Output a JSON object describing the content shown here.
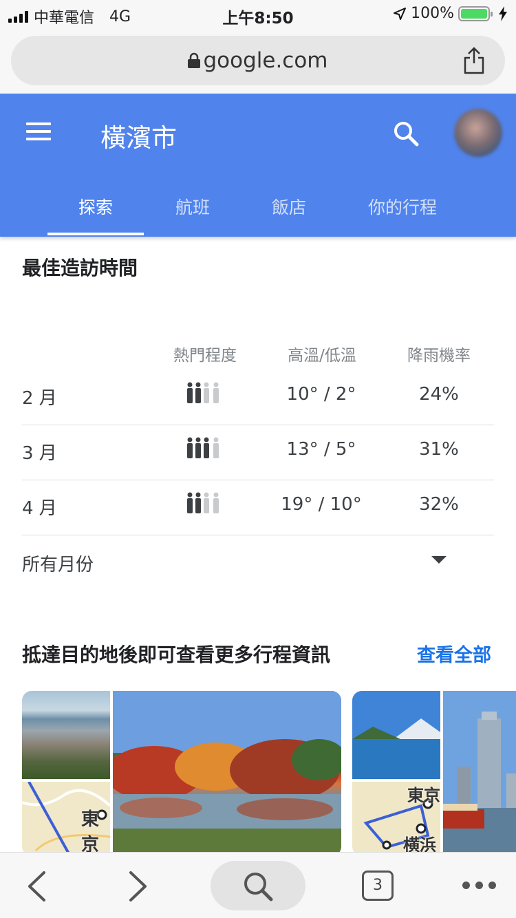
{
  "status_bar": {
    "carrier": "中華電信",
    "network": "4G",
    "time": "上午8:50",
    "battery": "100%"
  },
  "browser": {
    "url": "google.com"
  },
  "app_bar": {
    "title": "橫濱市",
    "tabs": [
      {
        "label": "探索",
        "active": true
      },
      {
        "label": "航班",
        "active": false
      },
      {
        "label": "飯店",
        "active": false
      },
      {
        "label": "你的行程",
        "active": false
      }
    ],
    "color": "#5083ec"
  },
  "best_time": {
    "title": "最佳造訪時間",
    "headers": {
      "popularity": "熱門程度",
      "temp": "高溫/低溫",
      "rain": "降雨機率"
    },
    "rows": [
      {
        "month": "2 月",
        "popularity_level": 2,
        "temp": "10° / 2°",
        "rain": "24%"
      },
      {
        "month": "3 月",
        "popularity_level": 3,
        "temp": "13° / 5°",
        "rain": "31%"
      },
      {
        "month": "4 月",
        "popularity_level": 2,
        "temp": "19° / 10°",
        "rain": "32%"
      }
    ],
    "all_months": "所有月份"
  },
  "itineraries": {
    "title": "抵達目的地後即可查看更多行程資訊",
    "see_all": "查看全部",
    "map_labels": [
      "東京",
      "東京",
      "横浜"
    ]
  },
  "bottom_bar": {
    "tab_count": "3"
  }
}
